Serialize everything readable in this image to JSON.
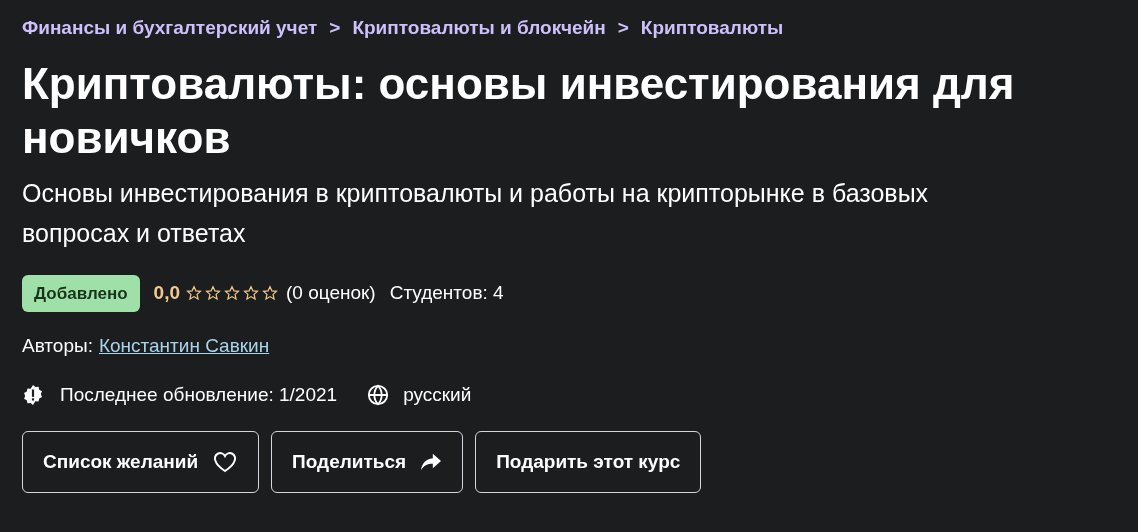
{
  "breadcrumbs": [
    {
      "label": "Финансы и бухгалтерский учет",
      "separator": ">"
    },
    {
      "label": "Криптовалюты и блокчейн",
      "separator": ">"
    },
    {
      "label": "Криптовалюты"
    }
  ],
  "title": "Криптовалюты: основы инвестирования для новичков",
  "subtitle": "Основы инвестирования в криптовалюты и работы на крипторынке в базовых вопросах и ответах",
  "badge": "Добавлено",
  "rating": {
    "value": "0,0",
    "stars": 0,
    "count": "(0 оценок)"
  },
  "students": "Студентов: 4",
  "authors": {
    "label": "Авторы:",
    "name": "Константин Савкин"
  },
  "updated": "Последнее обновление: 1/2021",
  "language": "русский",
  "buttons": [
    {
      "label": "Список желаний",
      "kind": "wishlist"
    },
    {
      "label": "Поделиться",
      "kind": "share"
    },
    {
      "label": "Подарить этот курс",
      "kind": "gift"
    }
  ]
}
